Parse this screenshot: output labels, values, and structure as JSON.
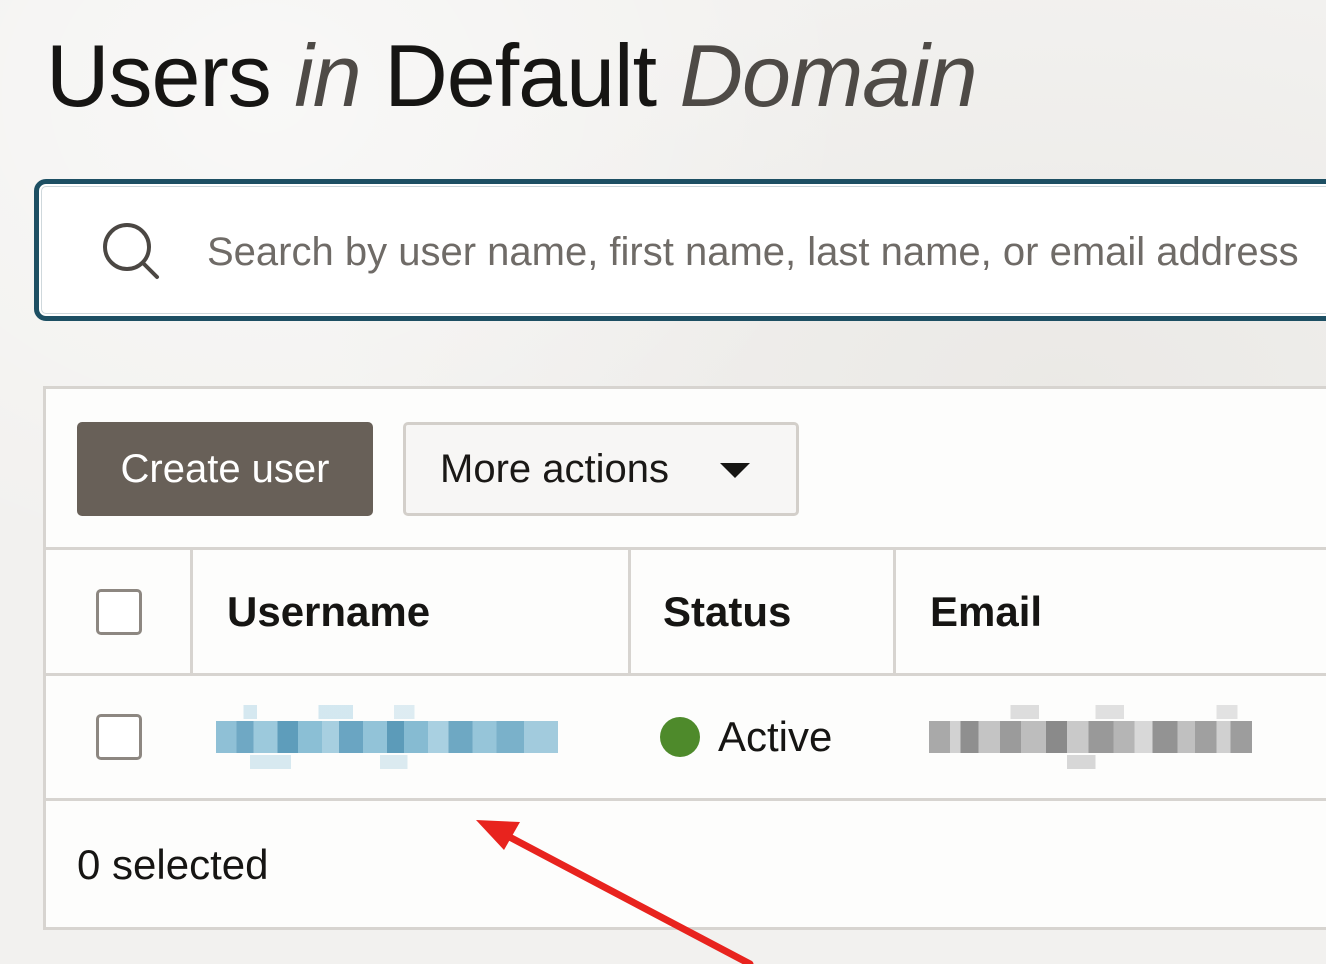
{
  "page": {
    "title_parts": [
      "Users",
      "in",
      "Default",
      "Domain"
    ]
  },
  "search": {
    "placeholder": "Search by user name, first name, last name, or email address"
  },
  "toolbar": {
    "create_label": "Create user",
    "more_label": "More actions"
  },
  "table": {
    "columns": [
      "Username",
      "Status",
      "Email"
    ],
    "rows": [
      {
        "username": "[redacted]",
        "status": "Active",
        "email": "[redacted]"
      }
    ]
  },
  "footer": {
    "selected_count": "0 selected"
  },
  "colors": {
    "accent_border": "#1d4f63",
    "primary_button": "#686058",
    "status_active": "#4e8a2b",
    "annotation_arrow": "#e8231e"
  },
  "icons": [
    "search-icon",
    "chevron-down-icon",
    "status-dot-icon",
    "annotation-arrow"
  ]
}
